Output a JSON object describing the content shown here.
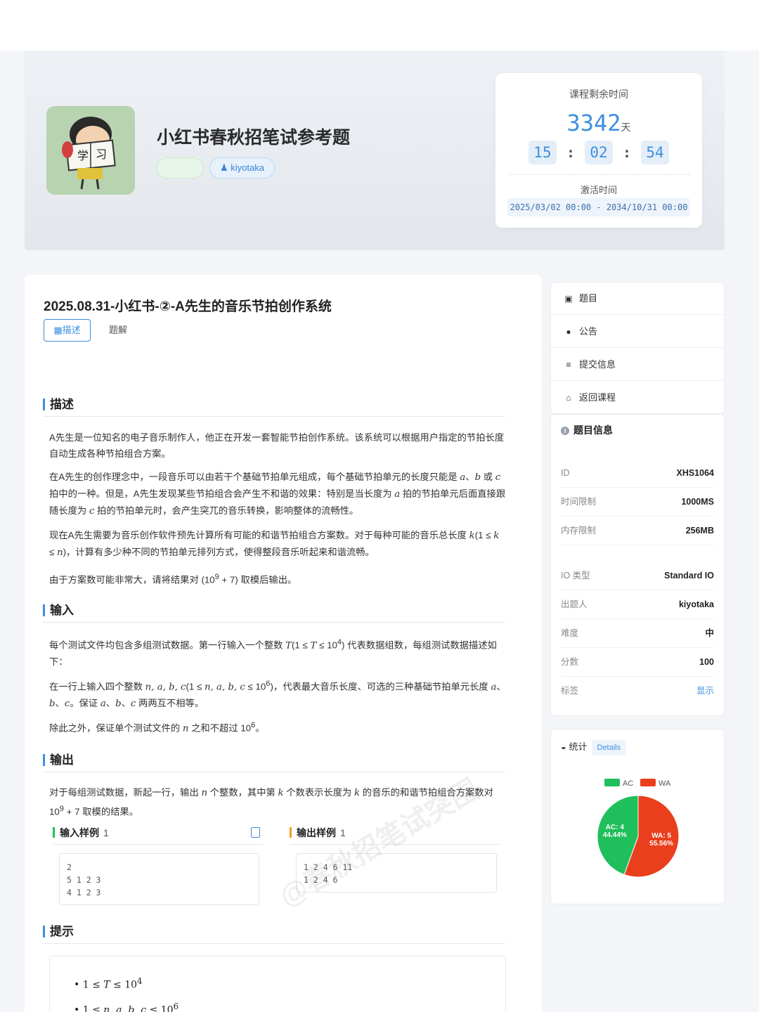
{
  "course": {
    "title": "小红书春秋招笔试参考题",
    "author": "kiyotaka"
  },
  "timer": {
    "label": "课程剩余时间",
    "days": "3342",
    "days_unit": "天",
    "hours": "15",
    "minutes": "02",
    "seconds": "54",
    "activation_label": "激活时间",
    "activation_range": "2025/03/02 00:00 - 2034/10/31 00:00"
  },
  "problem": {
    "title": "2025.08.31-小红书-②-A先生的音乐节拍创作系统",
    "tabs": [
      "描述",
      "题解"
    ],
    "sections": {
      "desc": "描述",
      "input": "输入",
      "output": "输出",
      "hint": "提示"
    },
    "desc_p1": "A先生是一位知名的电子音乐制作人，他正在开发一套智能节拍创作系统。该系统可以根据用户指定的节拍长度自动生成各种节拍组合方案。",
    "desc_p2a": "在A先生的创作理念中，一段音乐可以由若干个基础节拍单元组成，每个基础节拍单元的长度只能是 ",
    "desc_p2b": " 拍中的一种。但是，A先生发现某些节拍组合会产生不和谐的效果：特别是当长度为 ",
    "desc_p2c": " 拍的节拍单元后面直接跟随长度为 ",
    "desc_p2d": " 拍的节拍单元时，会产生突兀的音乐转换，影响整体的流畅性。",
    "desc_p3a": "现在A先生需要为音乐创作软件预先计算所有可能的和谐节拍组合方案数。对于每种可能的音乐总长度 ",
    "desc_p3b": "，计算有多少种不同的节拍单元排列方式，使得整段音乐听起来和谐流畅。",
    "desc_p4a": "由于方案数可能非常大，请将结果对 ",
    "desc_p4b": " 取模后输出。",
    "input_p1a": "每个测试文件均包含多组测试数据。第一行输入一个整数 ",
    "input_p1b": " 代表数据组数，每组测试数据描述如下：",
    "input_p2a": "在一行上输入四个整数 ",
    "input_p2b": "，代表最大音乐长度、可选的三种基础节拍单元长度 ",
    "input_p2c": " 两两互不相等。",
    "input_p3a": "除此之外，保证单个测试文件的 ",
    "input_p3b": " 之和不超过 ",
    "output_p1a": "对于每组测试数据，新起一行，输出 ",
    "output_p1b": " 个整数，其中第 ",
    "output_p1c": " 个数表示长度为 ",
    "output_p1d": " 的音乐的和谐节拍组合方案数对",
    "output_p1e": " 取模的结果。",
    "sample_in_label": "输入样例",
    "sample_in_no": "1",
    "sample_in": "2\n5 1 2 3\n4 1 2 3",
    "sample_out_label": "输出样例",
    "sample_out_no": "1",
    "sample_out": "1 2 4 6 11\n1 2 4 6",
    "watermark": "@春秋招笔试突围"
  },
  "sidebar": {
    "nav": [
      "题目",
      "公告",
      "提交信息",
      "返回课程"
    ],
    "info_title": "题目信息",
    "info": [
      {
        "k": "ID",
        "v": "XHS1064"
      },
      {
        "k": "时间限制",
        "v": "1000MS"
      },
      {
        "k": "内存限制",
        "v": "256MB"
      },
      {
        "k": "IO 类型",
        "v": "Standard IO"
      },
      {
        "k": "出题人",
        "v": "kiyotaka"
      },
      {
        "k": "难度",
        "v": "中"
      },
      {
        "k": "分数",
        "v": "100"
      },
      {
        "k": "标签",
        "v": "显示"
      }
    ],
    "stats_title": "统计",
    "stats_badge": "Details"
  },
  "chart_data": {
    "type": "pie",
    "categories": [
      "AC",
      "WA"
    ],
    "values": [
      4,
      5
    ],
    "labels": [
      "AC: 4\n44.44%",
      "WA: 5\n55.56%"
    ],
    "colors": [
      "#1fbf5b",
      "#ea3f1c"
    ],
    "legend": "top"
  }
}
